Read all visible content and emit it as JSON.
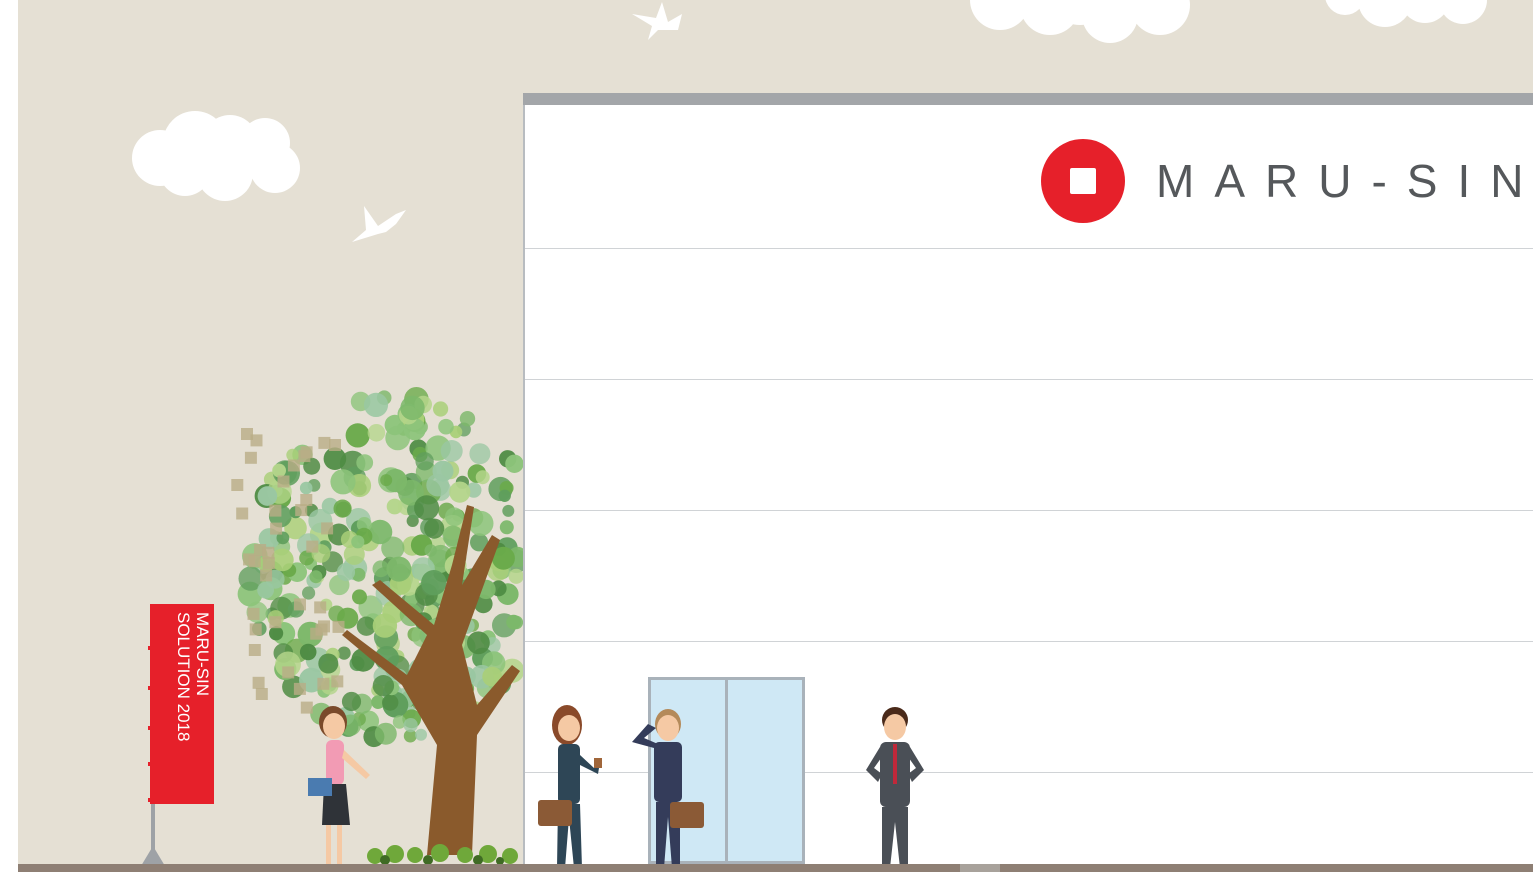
{
  "brand": {
    "name": "MARU-SIN",
    "accent_color": "#e6202a"
  },
  "banner": {
    "line1": "MARU-SIN",
    "line2": "SOLUTION 2018",
    "color": "#e6202a"
  },
  "scene": {
    "background_color": "#e5e0d4",
    "icons": [
      "cloud-icon",
      "bird-icon",
      "tree-icon",
      "person-icon",
      "door-icon"
    ]
  }
}
